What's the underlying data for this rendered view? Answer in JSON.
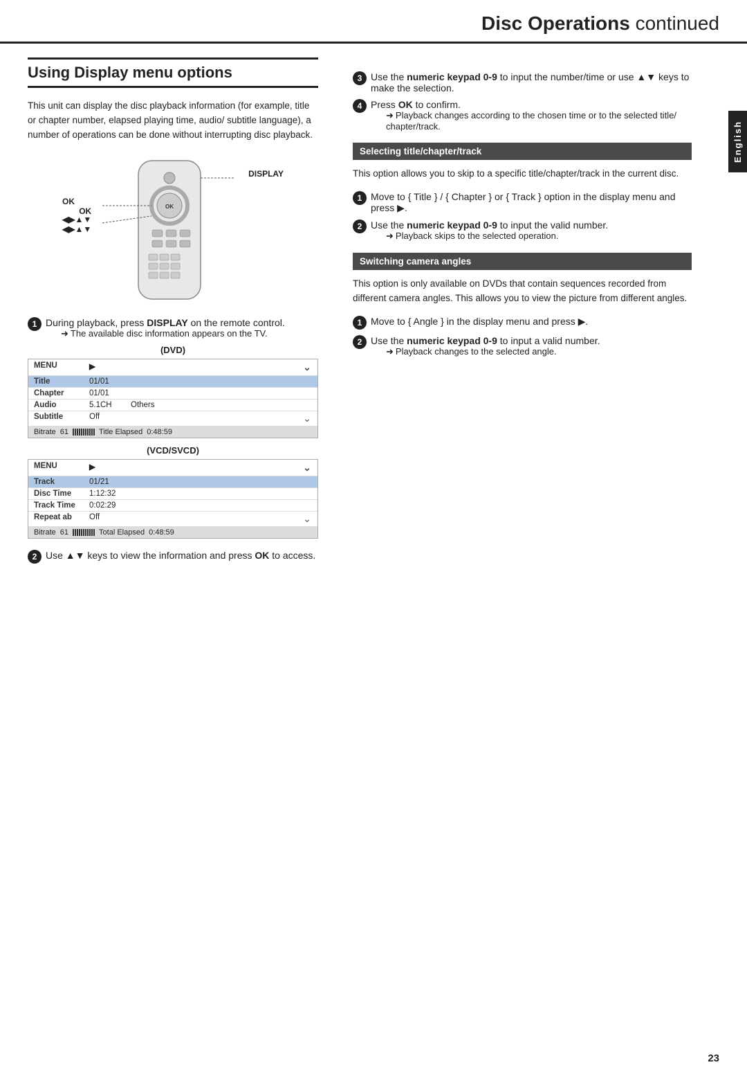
{
  "header": {
    "title": "Disc Operations",
    "subtitle": "continued"
  },
  "english_tab": "English",
  "page_number": "23",
  "left": {
    "section_heading": "Using Display menu options",
    "intro_text": "This unit can display the disc playback information (for example, title or chapter number, elapsed playing time, audio/ subtitle language), a number of operations can be done without interrupting disc playback.",
    "remote_labels": {
      "ok": "OK",
      "arrows": "◀▶▲▼",
      "display": "DISPLAY"
    },
    "step1": {
      "number": "1",
      "text_before_bold": "During playback, press ",
      "bold": "DISPLAY",
      "text_after": " on the remote control.",
      "arrow_text": "The available disc information appears on the TV."
    },
    "dvd_label": "(DVD)",
    "dvd_panel": {
      "header_col1": "MENU",
      "header_col2": "▶",
      "rows": [
        {
          "col1": "Title",
          "col2": "01/01",
          "col3": "",
          "highlight": true
        },
        {
          "col1": "Chapter",
          "col2": "01/01",
          "col3": "",
          "highlight": false
        },
        {
          "col1": "Audio",
          "col2": "5.1CH",
          "col3": "Others",
          "highlight": false
        },
        {
          "col1": "Subtitle",
          "col2": "Off",
          "col3": "",
          "highlight": false
        }
      ],
      "bitrate_label": "Bitrate",
      "bitrate_value": "61",
      "elapsed_label": "Title Elapsed",
      "elapsed_value": "0:48:59"
    },
    "vcdsvcd_label": "(VCD/SVCD)",
    "vcd_panel": {
      "header_col1": "MENU",
      "header_col2": "▶",
      "rows": [
        {
          "col1": "Track",
          "col2": "01/21",
          "col3": "",
          "highlight": true
        },
        {
          "col1": "Disc Time",
          "col2": "1:12:32",
          "col3": "",
          "highlight": false
        },
        {
          "col1": "Track Time",
          "col2": "0:02:29",
          "col3": "",
          "highlight": false
        },
        {
          "col1": "Repeat ab",
          "col2": "Off",
          "col3": "",
          "highlight": false
        }
      ],
      "bitrate_label": "Bitrate",
      "bitrate_value": "61",
      "elapsed_label": "Total Elapsed",
      "elapsed_value": "0:48:59"
    },
    "step2": {
      "number": "2",
      "text_before_bold": "Use ▲▼ keys to view the information and press ",
      "bold": "OK",
      "text_after": " to access."
    }
  },
  "right": {
    "step3": {
      "number": "3",
      "text_before_bold": "Use the ",
      "bold": "numeric keypad 0-9",
      "text_after": " to input the number/time or use ▲▼ keys to make the selection."
    },
    "step4": {
      "number": "4",
      "text_before_bold": "Press ",
      "bold": "OK",
      "text_after": " to confirm.",
      "arrow_text1": "Playback changes according to the chosen time or to the selected title/ chapter/track."
    },
    "section1": {
      "heading": "Selecting title/chapter/track",
      "intro": "This option allows you to skip to a specific title/chapter/track in the current disc.",
      "step1": {
        "number": "1",
        "text": "Move to { Title } / { Chapter } or { Track } option in the display menu and press ▶.",
        "bold_parts": ""
      },
      "step2": {
        "number": "2",
        "text_before_bold": "Use the ",
        "bold": "numeric keypad 0-9",
        "text_after": " to input the valid number.",
        "arrow_text": "Playback skips to the selected operation."
      }
    },
    "section2": {
      "heading": "Switching camera angles",
      "intro": "This option is only available on DVDs that contain sequences recorded from different camera angles. This allows you to view the picture from different angles.",
      "step1": {
        "number": "1",
        "text": "Move to { Angle } in the display menu and press ▶."
      },
      "step2": {
        "number": "2",
        "text_before_bold": "Use the ",
        "bold": "numeric keypad 0-9",
        "text_after": " to input a valid number.",
        "arrow_text": "Playback changes to the selected angle."
      }
    }
  }
}
